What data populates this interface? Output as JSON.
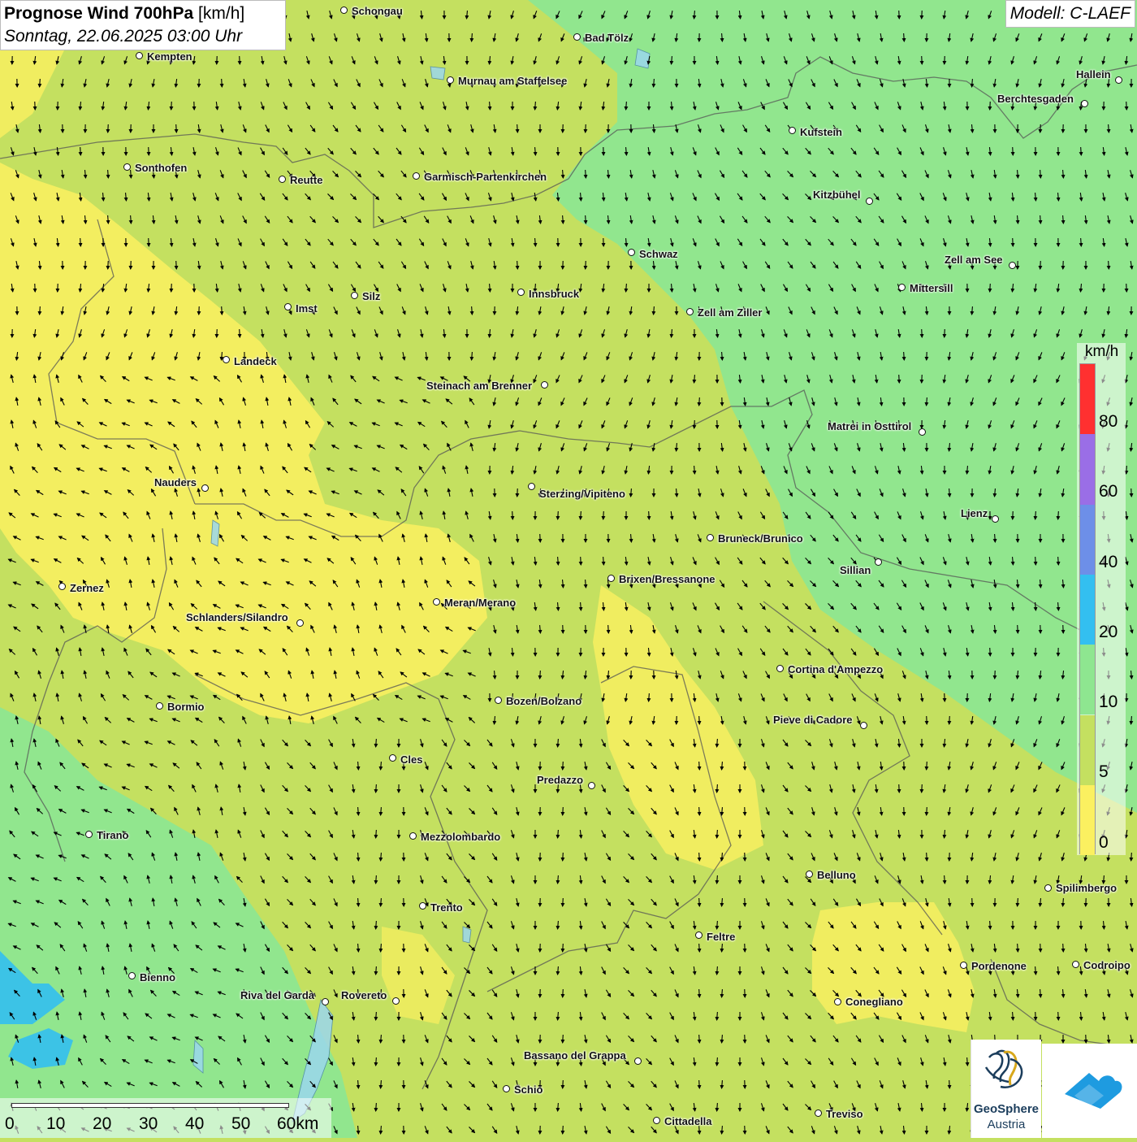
{
  "header": {
    "title_bold": "Prognose Wind 700hPa",
    "title_unit": "[km/h]",
    "datetime": "Sonntag, 22.06.2025 03:00 Uhr",
    "model": "Modell: C-LAEF"
  },
  "legend": {
    "unit": "km/h",
    "ticks": [
      "80",
      "60",
      "40",
      "20",
      "10",
      "5",
      "0"
    ],
    "colors": [
      "#ff3030",
      "#9a6ee6",
      "#6d8fe8",
      "#33bff0",
      "#8ee690",
      "#c4e060",
      "#fbf060"
    ]
  },
  "scale_bar": {
    "labels": [
      "0",
      "10",
      "20",
      "30",
      "40",
      "50",
      "60km"
    ]
  },
  "logos": {
    "geosphere_line1": "GeoSphere",
    "geosphere_line2": "Austria"
  },
  "places": [
    {
      "name": "Schongau"
    },
    {
      "name": "Bad Tölz"
    },
    {
      "name": "Kempten"
    },
    {
      "name": "Murnau am Staffelsee"
    },
    {
      "name": "Hallein"
    },
    {
      "name": "Berchtesgaden"
    },
    {
      "name": "Kufstein"
    },
    {
      "name": "Sonthofen"
    },
    {
      "name": "Reutte"
    },
    {
      "name": "Garmisch-Partenkirchen"
    },
    {
      "name": "Kitzbühel"
    },
    {
      "name": "Schwaz"
    },
    {
      "name": "Zell am See"
    },
    {
      "name": "Mittersill"
    },
    {
      "name": "Innsbruck"
    },
    {
      "name": "Silz"
    },
    {
      "name": "Imst"
    },
    {
      "name": "Zell am Ziller"
    },
    {
      "name": "Landeck"
    },
    {
      "name": "Steinach am Brenner"
    },
    {
      "name": "Matrei in Osttirol"
    },
    {
      "name": "Nauders"
    },
    {
      "name": "Sterzing/Vipiteno"
    },
    {
      "name": "Lienz"
    },
    {
      "name": "Bruneck/Brunico"
    },
    {
      "name": "Sillian"
    },
    {
      "name": "Brixen/Bressanone"
    },
    {
      "name": "Zernez"
    },
    {
      "name": "Meran/Merano"
    },
    {
      "name": "Schlanders/Silandro"
    },
    {
      "name": "Cortina d'Ampezzo"
    },
    {
      "name": "Bozen/Bolzano"
    },
    {
      "name": "Bormio"
    },
    {
      "name": "Pieve di Cadore"
    },
    {
      "name": "Cles"
    },
    {
      "name": "Predazzo"
    },
    {
      "name": "Tirano"
    },
    {
      "name": "Mezzolombardo"
    },
    {
      "name": "Belluno"
    },
    {
      "name": "Spilimbergo"
    },
    {
      "name": "Trento"
    },
    {
      "name": "Feltre"
    },
    {
      "name": "Bienno"
    },
    {
      "name": "Pordenone"
    },
    {
      "name": "Codroipo"
    },
    {
      "name": "Riva del Garda"
    },
    {
      "name": "Rovereto"
    },
    {
      "name": "Conegliano"
    },
    {
      "name": "Bassano del Grappa"
    },
    {
      "name": "Schio"
    },
    {
      "name": "Treviso"
    },
    {
      "name": "Cittadella"
    }
  ]
}
